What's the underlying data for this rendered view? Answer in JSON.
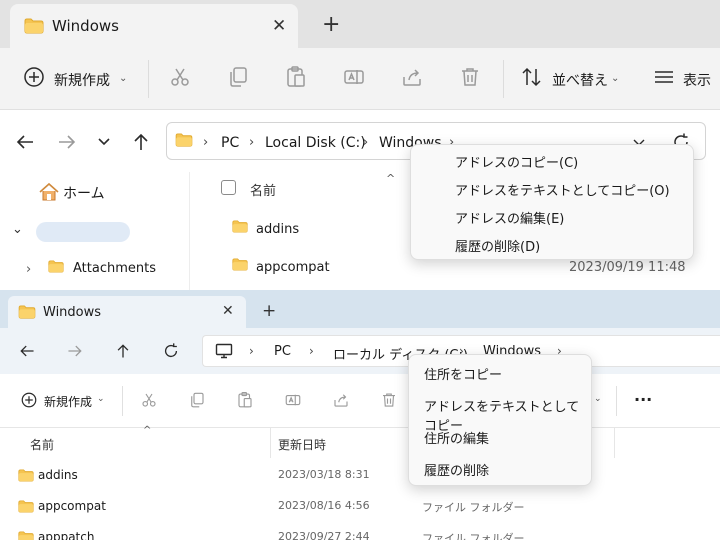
{
  "top": {
    "tab_title": "Windows",
    "toolbar": {
      "new_label": "新規作成",
      "sort_label": "並べ替え",
      "view_label": "表示"
    },
    "breadcrumb": [
      "PC",
      "Local Disk (C:)",
      "Windows"
    ],
    "sidebar": {
      "home": "ホーム",
      "attachments": "Attachments"
    },
    "list": {
      "col_name": "名前",
      "rows": [
        {
          "name": "addins",
          "date": ""
        },
        {
          "name": "appcompat",
          "date": "2023/09/19 11:48"
        }
      ]
    },
    "context_menu": [
      "アドレスのコピー(C)",
      "アドレスをテキストとしてコピー(O)",
      "アドレスの編集(E)",
      "履歴の削除(D)"
    ]
  },
  "bottom": {
    "tab_title": "Windows",
    "breadcrumb": [
      "PC",
      "ローカル ディスク (C:)",
      "Windows"
    ],
    "toolbar": {
      "new_label": "新規作成",
      "more_label": "..."
    },
    "columns": {
      "name": "名前",
      "date": "更新日時"
    },
    "rows": [
      {
        "name": "addins",
        "date": "2023/03/18 8:31",
        "type": ""
      },
      {
        "name": "appcompat",
        "date": "2023/08/16 4:56",
        "type": "ファイル フォルダー"
      },
      {
        "name": "apppatch",
        "date": "2023/09/27 2:44",
        "type": "ファイル フォルダー"
      }
    ],
    "context_menu": [
      "住所をコピー",
      "アドレスをテキストとしてコピー",
      "住所の編集",
      "履歴の削除"
    ]
  },
  "colors": {
    "folder": "#f5c451",
    "folder_dark": "#e0a92e",
    "accent": "#0067c0"
  },
  "icons": [
    "folder-icon",
    "close-icon",
    "plus-icon",
    "new-icon",
    "cut-icon",
    "copy-icon",
    "paste-icon",
    "rename-icon",
    "share-icon",
    "delete-icon",
    "sort-icon",
    "view-icon",
    "back-icon",
    "forward-icon",
    "up-icon",
    "refresh-icon",
    "pc-icon",
    "home-icon",
    "more-icon"
  ]
}
